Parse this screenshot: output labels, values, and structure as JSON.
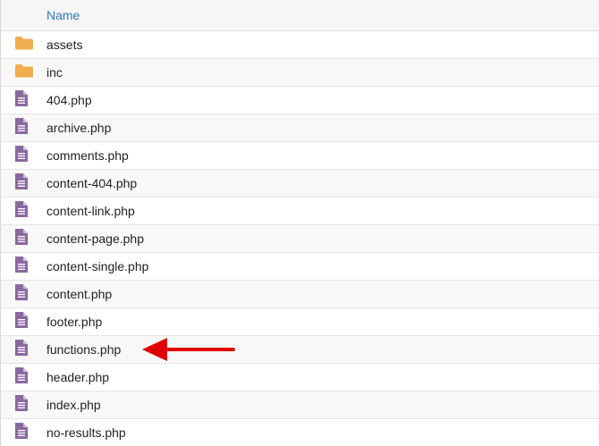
{
  "header": {
    "name_label": "Name"
  },
  "rows": [
    {
      "name": "assets",
      "type": "folder"
    },
    {
      "name": "inc",
      "type": "folder"
    },
    {
      "name": "404.php",
      "type": "file"
    },
    {
      "name": "archive.php",
      "type": "file"
    },
    {
      "name": "comments.php",
      "type": "file"
    },
    {
      "name": "content-404.php",
      "type": "file"
    },
    {
      "name": "content-link.php",
      "type": "file"
    },
    {
      "name": "content-page.php",
      "type": "file"
    },
    {
      "name": "content-single.php",
      "type": "file"
    },
    {
      "name": "content.php",
      "type": "file"
    },
    {
      "name": "footer.php",
      "type": "file"
    },
    {
      "name": "functions.php",
      "type": "file"
    },
    {
      "name": "header.php",
      "type": "file"
    },
    {
      "name": "index.php",
      "type": "file"
    },
    {
      "name": "no-results.php",
      "type": "file"
    }
  ],
  "colors": {
    "folder": "#f0ad4e",
    "file": "#8a6a9e",
    "arrow": "#e00000",
    "header_link": "#2a7ab8"
  },
  "icons": {
    "folder": "folder-icon",
    "file": "file-icon"
  },
  "annotation": {
    "arrow_points_to": "functions.php"
  }
}
